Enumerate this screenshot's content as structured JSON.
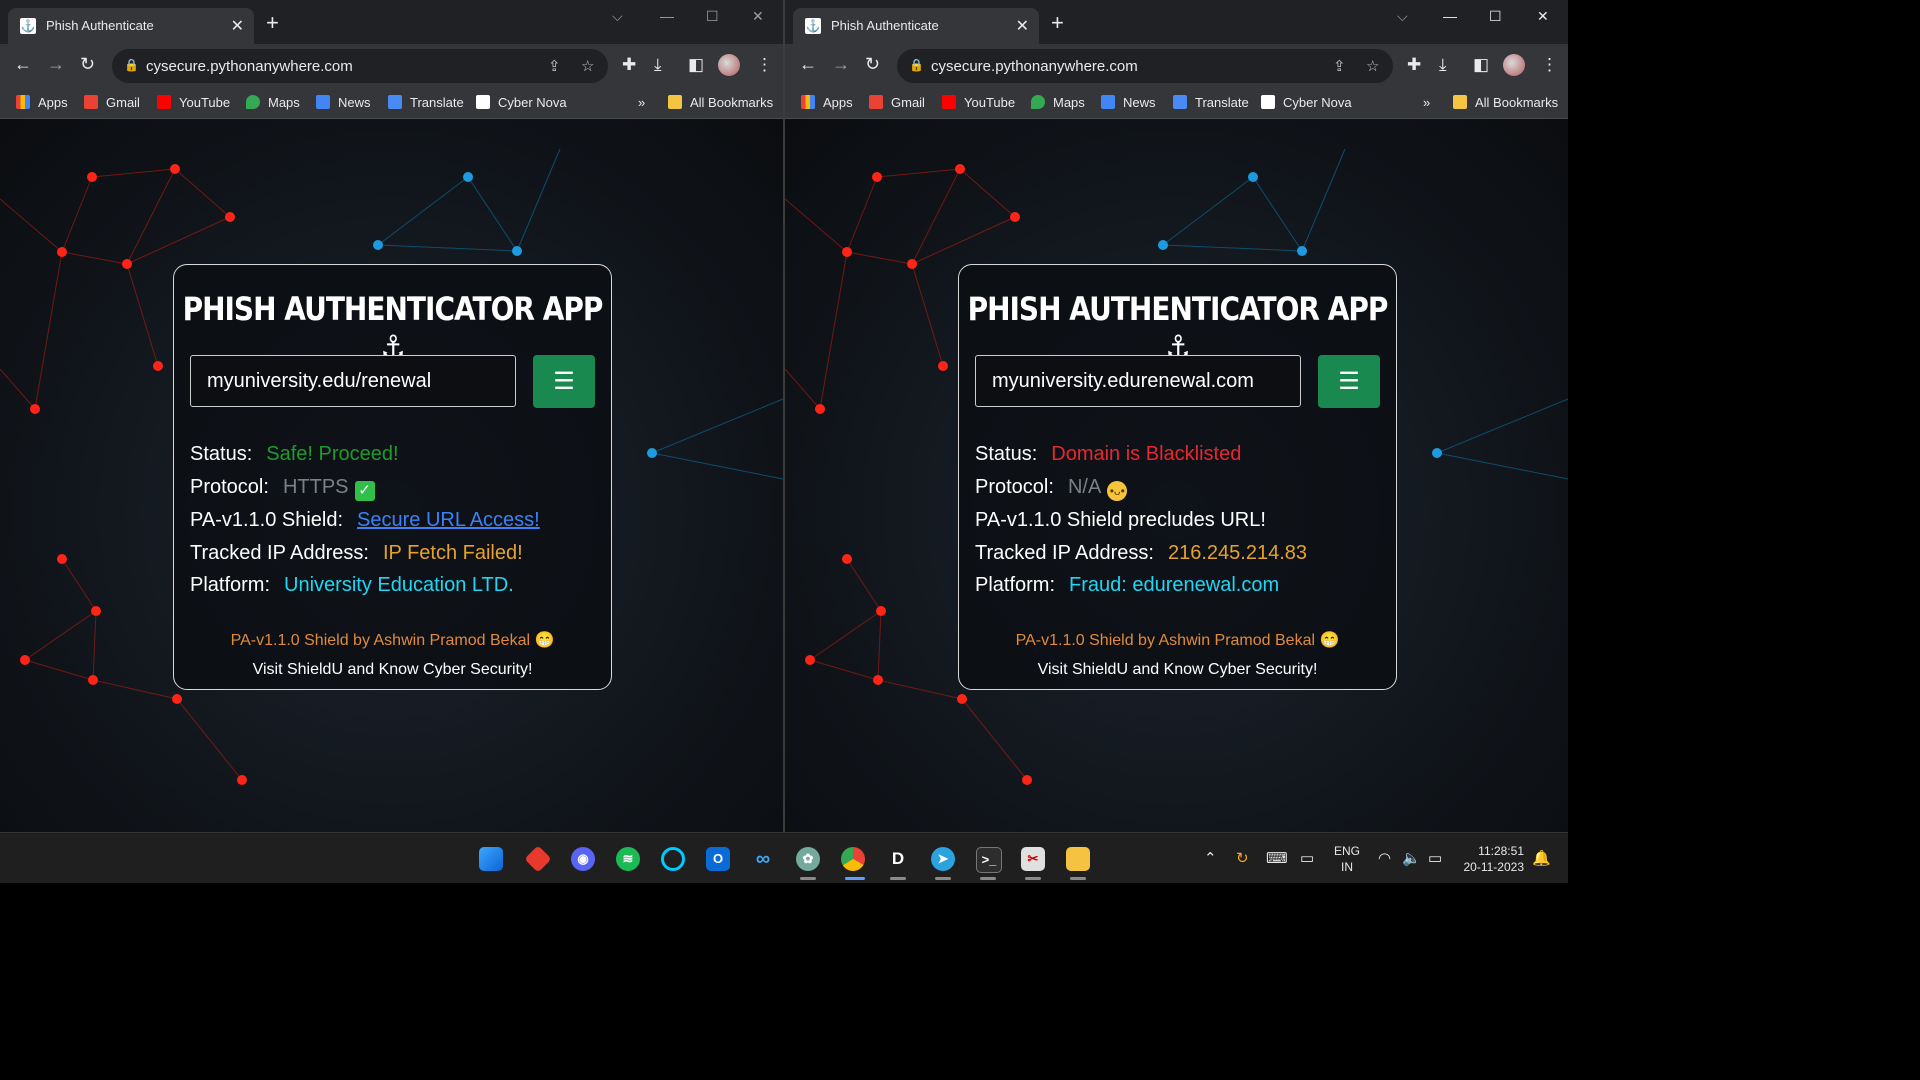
{
  "browser": {
    "tab_title": "Phish Authenticate",
    "url": "cysecure.pythonanywhere.com",
    "bookmarks": [
      "Apps",
      "Gmail",
      "YouTube",
      "Maps",
      "News",
      "Translate",
      "Cyber Nova"
    ],
    "all_bookmarks": "All Bookmarks",
    "overflow": "»"
  },
  "app": {
    "title": "PHISH AUTHENTICATOR APP ⚓",
    "labels": {
      "status": "Status:",
      "protocol": "Protocol:",
      "tracked_ip": "Tracked IP Address:",
      "platform": "Platform:"
    },
    "credit": "PA-v1.1.0 Shield by Ashwin Pramod Bekal 😁",
    "visit": "Visit ShieldU and Know Cyber Security!"
  },
  "left_result": {
    "input_value": "myuniversity.edu/renewal",
    "status": "Safe! Proceed!",
    "protocol": "HTTPS",
    "shield_label": "PA-v1.1.0 Shield:",
    "shield_link": "Secure URL Access!",
    "tracked_ip": "IP Fetch Failed!",
    "platform": "University Education LTD."
  },
  "right_result": {
    "input_value": "myuniversity.edurenewal.com",
    "status": "Domain is Blacklisted",
    "protocol": "N/A",
    "shield_text": "PA-v1.1.0 Shield precludes URL!",
    "tracked_ip": "216.245.214.83",
    "platform": "Fraud: edurenewal.com"
  },
  "taskbar": {
    "lang_top": "ENG",
    "lang_bottom": "IN",
    "time": "11:28:51",
    "date": "20-11-2023"
  }
}
